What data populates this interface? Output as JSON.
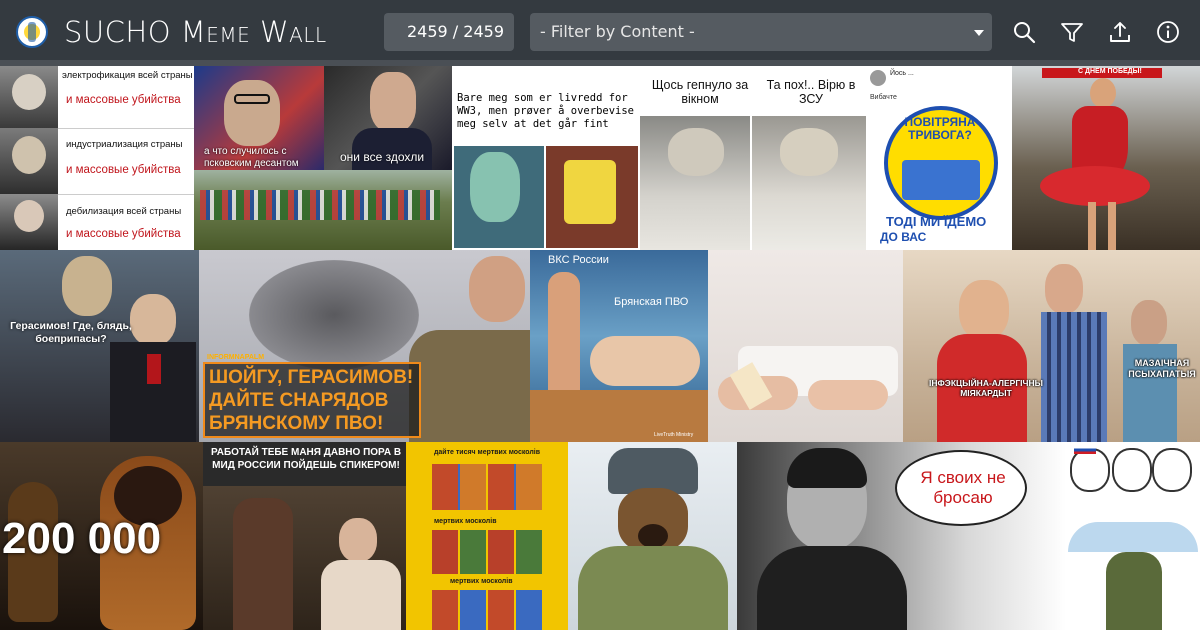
{
  "header": {
    "title": "SUCHO Meme Wall",
    "counter": "2459 / 2459",
    "filter_label": "- Filter by Content -",
    "icons": [
      "logo-icon",
      "search-icon",
      "filter-icon",
      "upload-icon",
      "info-icon"
    ],
    "colors": {
      "bar": "#343a40",
      "control": "#555b61",
      "text": "#ffffff"
    }
  },
  "memes": {
    "lenin": {
      "row1": "электрофикация всей страны",
      "row1b": "и массовые убийства",
      "row2": "индустриализация страны",
      "row2b": "и массовые убийства",
      "row3": "дебилизация всей страны",
      "row3b": "и массовые убийства"
    },
    "putin": {
      "left": "а что случилось с псковским десантом",
      "right": "они все здохли"
    },
    "squid": {
      "text": "Bare meg som er livredd for WW3, men prøver å overbevise meg selv at det går fint"
    },
    "cat": {
      "left": "Щось гепнуло за вікном",
      "right": "Та пох!.. Вірю в ЗСУ"
    },
    "tweet": {
      "user": "Йось ...",
      "sub": "Вибачте",
      "poster": "ПОВІТРЯНА ТРИВОГА?",
      "bottom1": "ТОДІ МИ ЇДЕМО",
      "bottom2": "ДО ВАС"
    },
    "dancer": {
      "banner": "С ДНЕМ ПОБЕДЫ!"
    },
    "gerasimov": {
      "text": "Герасимов! Где, блядь, боеприпасы?"
    },
    "shoigu": {
      "brand": "INFORMNAPALM",
      "text": "ШОЙГУ, ГЕРАСИМОВ! ДАЙТЕ СНАРЯДОВ БРЯНСКОМУ ПВО!"
    },
    "painting": {
      "top": "ВКС России",
      "right": "Брянская ПВО",
      "credit": "LiveTruth Ministry"
    },
    "morgue": {},
    "distracted": {
      "left": "ІНФЭКЦЫЙНА-АЛЕРГІЧНЫ МІЯКАРДЫТ",
      "right": "МАЗАІЧНАЯ ПСЫХАПАТЫЯ"
    },
    "dolls": {
      "text": "200 000"
    },
    "zakharova": {
      "text": "РАБОТАЙ ТЕБЕ МАНЯ ДАВНО ПОРА В МИД РОССИИ ПОЙДЕШЬ СПИКЕРОМ!"
    },
    "beatles": {
      "title": "дайте тисяч мертвих москолів",
      "mid1": "мертвих москолів",
      "mid2": "мертвих москолів"
    },
    "dog": {},
    "kobzon": {
      "bubble": "Я своих не бросаю"
    },
    "soyjak": {}
  }
}
